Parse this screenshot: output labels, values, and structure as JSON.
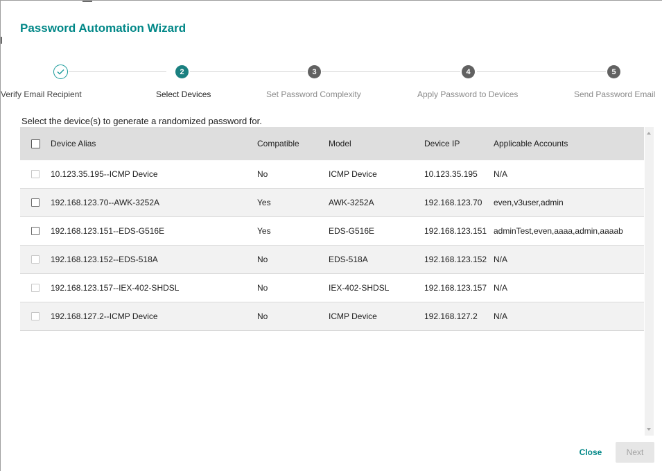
{
  "dialog": {
    "title": "Password Automation Wizard"
  },
  "stepper": {
    "steps": [
      {
        "number": "1",
        "label": "Verify Email Recipient",
        "state": "done",
        "icon": "check-icon"
      },
      {
        "number": "2",
        "label": "Select Devices",
        "state": "active"
      },
      {
        "number": "3",
        "label": "Set Password Complexity",
        "state": "pending"
      },
      {
        "number": "4",
        "label": "Apply Password to Devices",
        "state": "pending"
      },
      {
        "number": "5",
        "label": "Send Password Email",
        "state": "pending"
      }
    ]
  },
  "instruction": "Select the device(s) to generate a randomized password for.",
  "table": {
    "columns": [
      "Device Alias",
      "Compatible",
      "Model",
      "Device IP",
      "Applicable Accounts"
    ],
    "rows": [
      {
        "alias": "10.123.35.195--ICMP Device",
        "compatible": "No",
        "model": "ICMP Device",
        "ip": "10.123.35.195",
        "accounts": "N/A"
      },
      {
        "alias": "192.168.123.70--AWK-3252A",
        "compatible": "Yes",
        "model": "AWK-3252A",
        "ip": "192.168.123.70",
        "accounts": "even,v3user,admin"
      },
      {
        "alias": "192.168.123.151--EDS-G516E",
        "compatible": "Yes",
        "model": "EDS-G516E",
        "ip": "192.168.123.151",
        "accounts": "adminTest,even,aaaa,admin,aaaab"
      },
      {
        "alias": "192.168.123.152--EDS-518A",
        "compatible": "No",
        "model": "EDS-518A",
        "ip": "192.168.123.152",
        "accounts": "N/A"
      },
      {
        "alias": "192.168.123.157--IEX-402-SHDSL",
        "compatible": "No",
        "model": "IEX-402-SHDSL",
        "ip": "192.168.123.157",
        "accounts": "N/A"
      },
      {
        "alias": "192.168.127.2--ICMP Device",
        "compatible": "No",
        "model": "ICMP Device",
        "ip": "192.168.127.2",
        "accounts": "N/A"
      }
    ]
  },
  "footer": {
    "close_label": "Close",
    "next_label": "Next"
  },
  "colors": {
    "accent": "#008787",
    "active_step": "#1a8080",
    "pending_step": "#616161",
    "header_bg": "#dedede",
    "alt_row_bg": "#f2f2f2"
  }
}
